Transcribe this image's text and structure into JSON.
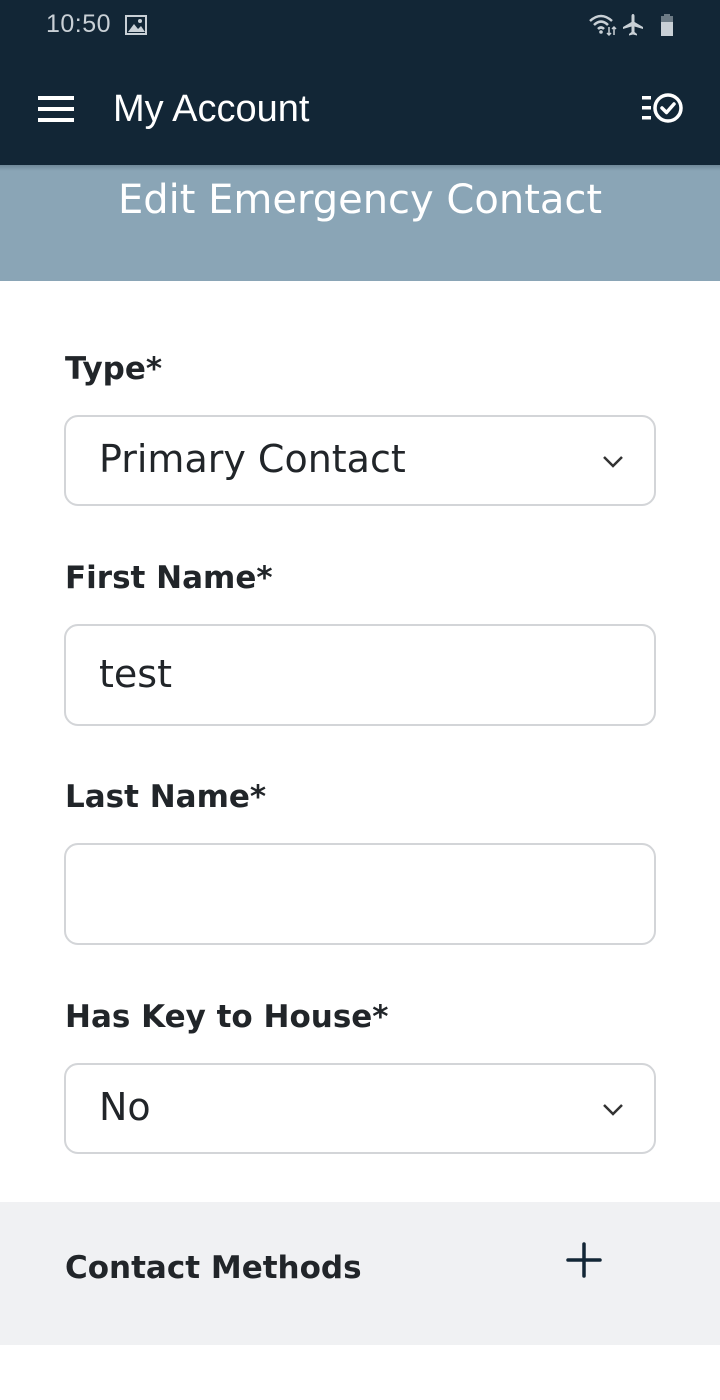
{
  "status_bar": {
    "time": "10:50",
    "icons": [
      "image-icon",
      "wifi-icon",
      "airplane-mode-icon",
      "battery-icon"
    ]
  },
  "app_bar": {
    "title": "My Account",
    "left_icon": "hamburger-menu-icon",
    "right_icon": "checklist-icon"
  },
  "page": {
    "title": "Edit Emergency Contact"
  },
  "form": {
    "type": {
      "label": "Type*",
      "value": "Primary Contact"
    },
    "first_name": {
      "label": "First Name*",
      "value": "test"
    },
    "last_name": {
      "label": "Last Name*",
      "value": ""
    },
    "has_key": {
      "label": "Has Key to House*",
      "value": "No"
    }
  },
  "contact_methods": {
    "title": "Contact Methods",
    "add_icon": "plus-icon"
  },
  "colors": {
    "app_bar": "#122636",
    "page_header": "#8aa5b6",
    "section_bg": "#f0f1f3",
    "text": "#212529"
  }
}
